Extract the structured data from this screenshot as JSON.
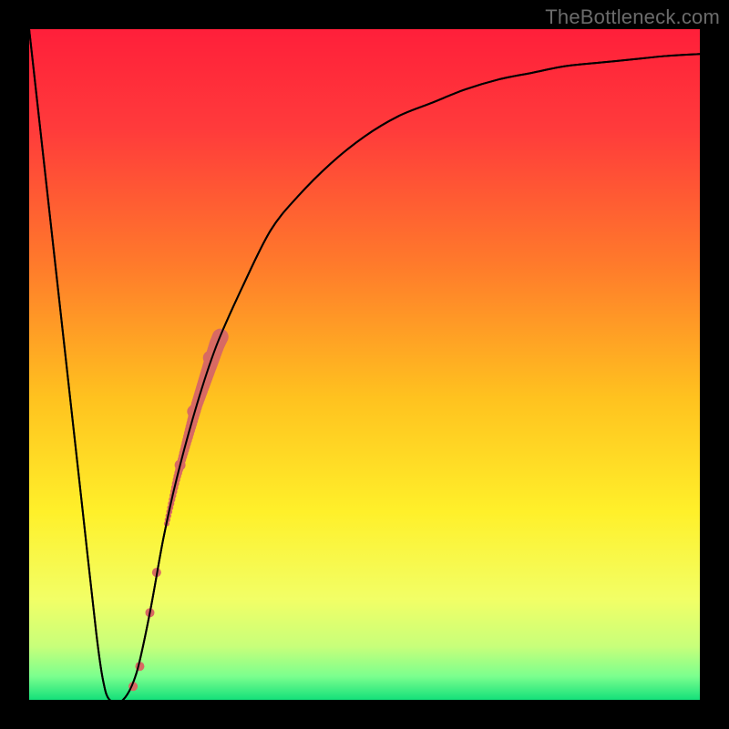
{
  "watermark": "TheBottleneck.com",
  "chart_data": {
    "type": "line",
    "title": "",
    "xlabel": "",
    "ylabel": "",
    "xlim": [
      0,
      100
    ],
    "ylim": [
      0,
      100
    ],
    "grid": false,
    "series": [
      {
        "name": "bottleneck-curve",
        "x": [
          0,
          2,
          4,
          6,
          8,
          10,
          11,
          12,
          14,
          16,
          18,
          20,
          22,
          25,
          28,
          32,
          36,
          40,
          45,
          50,
          55,
          60,
          65,
          70,
          75,
          80,
          85,
          90,
          95,
          100
        ],
        "values": [
          100,
          82,
          64,
          46,
          28,
          10,
          3,
          0,
          0,
          4,
          13,
          24,
          33,
          44,
          53,
          62,
          70,
          75,
          80,
          84,
          87,
          89,
          91,
          92.5,
          93.5,
          94.5,
          95,
          95.5,
          96,
          96.3
        ]
      }
    ],
    "markers": [
      {
        "name": "marker-segment-1",
        "x": 22.5,
        "y": 35,
        "size": 6
      },
      {
        "name": "marker-segment-2",
        "x": 24.5,
        "y": 43,
        "size": 7
      },
      {
        "name": "marker-segment-3",
        "x": 27.0,
        "y": 51,
        "size": 8
      },
      {
        "name": "marker-gap-dot-1",
        "x": 19.0,
        "y": 19,
        "size": 5
      },
      {
        "name": "marker-gap-dot-2",
        "x": 18.0,
        "y": 13,
        "size": 5
      },
      {
        "name": "marker-bottom-dot-1",
        "x": 16.5,
        "y": 5,
        "size": 5
      },
      {
        "name": "marker-bottom-dot-2",
        "x": 15.5,
        "y": 2,
        "size": 5
      }
    ],
    "gradient_stops": [
      {
        "offset": 0.0,
        "color": "#ff1f3a"
      },
      {
        "offset": 0.15,
        "color": "#ff3b3b"
      },
      {
        "offset": 0.35,
        "color": "#ff7a2b"
      },
      {
        "offset": 0.55,
        "color": "#ffc21f"
      },
      {
        "offset": 0.72,
        "color": "#fff02a"
      },
      {
        "offset": 0.85,
        "color": "#f2ff66"
      },
      {
        "offset": 0.92,
        "color": "#c8ff7a"
      },
      {
        "offset": 0.965,
        "color": "#7bff8e"
      },
      {
        "offset": 1.0,
        "color": "#14e07a"
      }
    ],
    "marker_color": "#d86a63",
    "curve_color": "#000000"
  }
}
